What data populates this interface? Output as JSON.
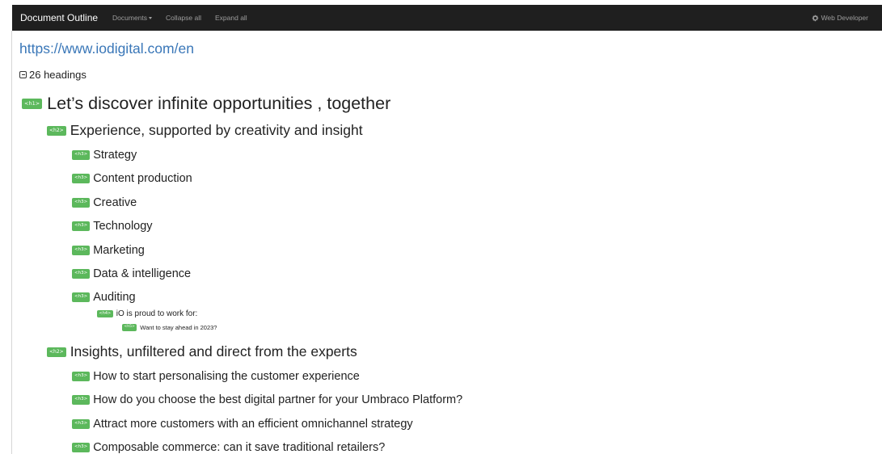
{
  "navbar": {
    "brand": "Document Outline",
    "documents_label": "Documents",
    "collapse_all": "Collapse all",
    "expand_all": "Expand all",
    "web_developer": "Web Developer"
  },
  "document": {
    "url": "https://www.iodigital.com/en",
    "heading_count": "26 headings"
  },
  "headings": [
    {
      "level": "h1",
      "tag": "<h1>",
      "text": "Let’s discover infinite opportunities , together"
    },
    {
      "level": "h2",
      "tag": "<h2>",
      "text": "Experience, supported by creativity and insight"
    },
    {
      "level": "h3",
      "tag": "<h3>",
      "text": "Strategy"
    },
    {
      "level": "h3",
      "tag": "<h3>",
      "text": "Content production"
    },
    {
      "level": "h3",
      "tag": "<h3>",
      "text": "Creative"
    },
    {
      "level": "h3",
      "tag": "<h3>",
      "text": "Technology"
    },
    {
      "level": "h3",
      "tag": "<h3>",
      "text": "Marketing"
    },
    {
      "level": "h3",
      "tag": "<h3>",
      "text": "Data & intelligence"
    },
    {
      "level": "h3",
      "tag": "<h3>",
      "text": "Auditing"
    },
    {
      "level": "h4",
      "tag": "<h4>",
      "text": "iO is proud to work for:"
    },
    {
      "level": "h5",
      "tag": "<h5>",
      "text": "Want to stay ahead in 2023?"
    },
    {
      "level": "h2",
      "tag": "<h2>",
      "text": "Insights, unfiltered and direct from the experts"
    },
    {
      "level": "h3",
      "tag": "<h3>",
      "text": "How to start personalising the customer experience"
    },
    {
      "level": "h3",
      "tag": "<h3>",
      "text": "How do you choose the best digital partner for your Umbraco Platform?"
    },
    {
      "level": "h3",
      "tag": "<h3>",
      "text": "Attract more customers with an efficient omnichannel strategy"
    },
    {
      "level": "h3",
      "tag": "<h3>",
      "text": "Composable commerce: can it save traditional retailers?"
    }
  ],
  "icons": {
    "gear": "gear-icon",
    "collapse_toggle": "collapse-toggle-icon",
    "dropdown_caret": "caret-down-icon"
  },
  "colors": {
    "navbar_bg": "#1f1f1f",
    "tag_green": "#5cb85c",
    "link_blue": "#3a77b8"
  }
}
